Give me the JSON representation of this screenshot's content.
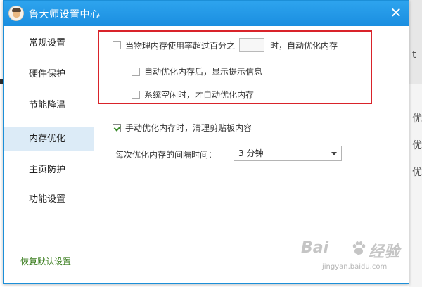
{
  "window": {
    "title": "鲁大师设置中心",
    "close_glyph": "✕"
  },
  "sidebar": {
    "items": [
      {
        "label": "常规设置",
        "active": false
      },
      {
        "label": "硬件保护",
        "active": false
      },
      {
        "label": "节能降温",
        "active": false
      },
      {
        "label": "内存优化",
        "active": true
      },
      {
        "label": "主页防护",
        "active": false
      },
      {
        "label": "功能设置",
        "active": false
      }
    ],
    "restore_label": "恢复默认设置"
  },
  "memory": {
    "threshold_prefix": "当物理内存使用率超过百分之",
    "threshold_value": "",
    "threshold_suffix": "时，自动优化内存",
    "threshold_checked": false,
    "notify_label": "自动优化内存后，显示提示信息",
    "notify_checked": false,
    "idle_label": "系统空闲时，才自动优化内存",
    "idle_checked": false,
    "manual_clipboard_label": "手动优化内存时，清理剪贴板内容",
    "manual_clipboard_checked": true,
    "interval_label": "每次优化内存的间隔时间：",
    "interval_value": "3 分钟"
  },
  "background": {
    "glyphs": [
      "t",
      "优",
      "优",
      "优"
    ]
  },
  "watermark": {
    "main_left": "Bai",
    "main_right": "经验",
    "sub": "jingyan.baidu.com"
  },
  "colors": {
    "titlebar": "#1a8ee0",
    "active_nav": "#dcebf7",
    "highlight_border": "#d9232a",
    "restore_link": "#3a7d1e"
  }
}
